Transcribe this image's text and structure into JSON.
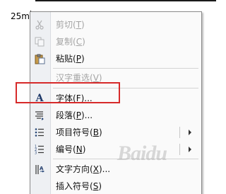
{
  "document": {
    "text": "25m"
  },
  "context_menu": {
    "items": [
      {
        "label": "剪切",
        "mnemonic": "T",
        "icon": "scissors-icon",
        "enabled": false
      },
      {
        "label": "复制",
        "mnemonic": "C",
        "icon": "copy-icon",
        "enabled": false
      },
      {
        "label": "粘贴",
        "mnemonic": "P",
        "icon": "paste-icon",
        "enabled": true
      },
      {
        "label": "汉字重选",
        "mnemonic": "V",
        "icon": "",
        "enabled": false
      },
      {
        "label": "字体",
        "mnemonic": "F",
        "suffix": "...",
        "icon": "font-icon",
        "enabled": true
      },
      {
        "label": "段落",
        "mnemonic": "P",
        "suffix": "...",
        "icon": "paragraph-icon",
        "enabled": true
      },
      {
        "label": "项目符号",
        "mnemonic": "B",
        "icon": "bullets-icon",
        "enabled": true,
        "submenu": true
      },
      {
        "label": "编号",
        "mnemonic": "N",
        "icon": "numbering-icon",
        "enabled": true,
        "submenu": true
      },
      {
        "label": "文字方向",
        "mnemonic": "X",
        "suffix": "...",
        "icon": "text-direction-icon",
        "enabled": true
      },
      {
        "label": "插入符号",
        "mnemonic": "S",
        "icon": "",
        "enabled": true
      }
    ]
  },
  "annotation": {
    "highlighted_item": "字体",
    "highlight_color": "#d62a2a"
  },
  "watermark": {
    "text": "Baidu"
  }
}
